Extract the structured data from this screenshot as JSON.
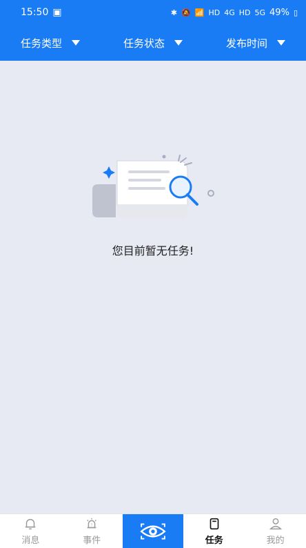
{
  "status": {
    "time": "15:50",
    "battery": "49%",
    "signal_label": "HD",
    "network_label": "4G",
    "network_label2": "5G"
  },
  "filters": [
    {
      "label": "任务类型"
    },
    {
      "label": "任务状态"
    },
    {
      "label": "发布时间"
    }
  ],
  "empty_state": {
    "message": "您目前暂无任务!"
  },
  "tabs": [
    {
      "label": "消息",
      "icon": "bell-icon"
    },
    {
      "label": "事件",
      "icon": "alarm-icon"
    },
    {
      "label": "",
      "icon": "eye-icon"
    },
    {
      "label": "任务",
      "icon": "document-icon"
    },
    {
      "label": "我的",
      "icon": "user-icon"
    }
  ],
  "colors": {
    "primary": "#1a7cf5",
    "background": "#e7e9f3"
  }
}
